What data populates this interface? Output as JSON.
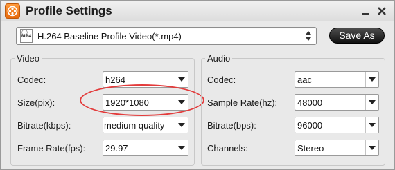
{
  "window": {
    "title": "Profile Settings"
  },
  "profile": {
    "selected": "H.264 Baseline Profile Video(*.mp4)",
    "icon_text": "MP4"
  },
  "toolbar": {
    "save_as_label": "Save As"
  },
  "video": {
    "title": "Video",
    "codec_label": "Codec:",
    "codec_value": "h264",
    "size_label": "Size(pix):",
    "size_value": "1920*1080",
    "bitrate_label": "Bitrate(kbps):",
    "bitrate_value": "medium quality",
    "framerate_label": "Frame Rate(fps):",
    "framerate_value": "29.97"
  },
  "audio": {
    "title": "Audio",
    "codec_label": "Codec:",
    "codec_value": "aac",
    "samplerate_label": "Sample Rate(hz):",
    "samplerate_value": "48000",
    "bitrate_label": "Bitrate(bps):",
    "bitrate_value": "96000",
    "channels_label": "Channels:",
    "channels_value": "Stereo"
  },
  "colors": {
    "accent": "#e86a0b",
    "highlight": "#e33b3b",
    "button": "#1a1a1a"
  }
}
